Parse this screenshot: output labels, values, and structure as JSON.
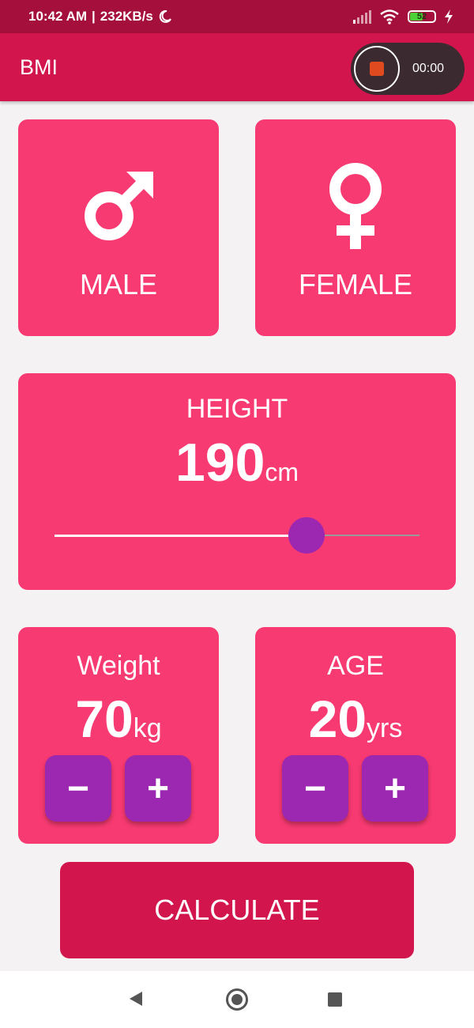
{
  "status_bar": {
    "time": "10:42 AM",
    "speed": "232KB/s",
    "battery": "52",
    "battery_level": 0.52
  },
  "app_bar": {
    "title": "BMI",
    "recorder_time": "00:00"
  },
  "gender": {
    "male_label": "MALE",
    "female_label": "FEMALE"
  },
  "height": {
    "label": "HEIGHT",
    "value": "190",
    "unit": "cm",
    "slider_fraction": 0.69
  },
  "weight": {
    "label": "Weight",
    "value": "70",
    "unit": "kg",
    "minus": "−",
    "plus": "+"
  },
  "age": {
    "label": "AGE",
    "value": "20",
    "unit": "yrs",
    "minus": "−",
    "plus": "+"
  },
  "calculate_label": "CALCULATE",
  "colors": {
    "status_bar": "#a50f3b",
    "app_bar": "#d2154d",
    "card": "#f83a72",
    "accent": "#9c27b0",
    "background": "#f4f2f3"
  },
  "icons": [
    "moon-icon",
    "signal-icon",
    "wifi-icon",
    "battery-icon",
    "charging-icon",
    "stop-record-icon",
    "male-icon",
    "female-icon",
    "back-icon",
    "home-icon",
    "recents-icon"
  ]
}
